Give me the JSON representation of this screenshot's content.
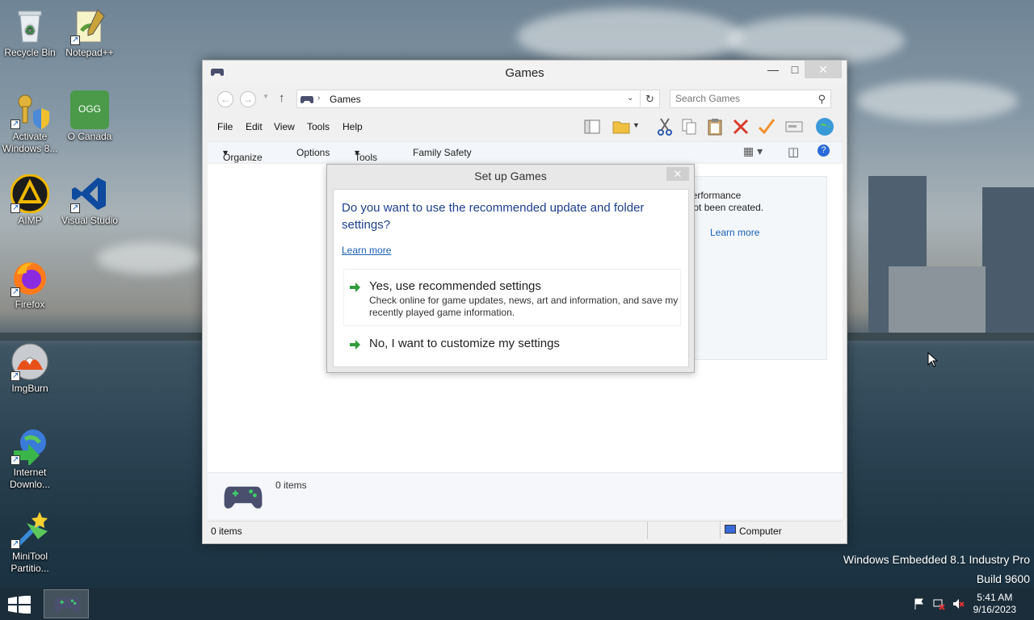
{
  "desktop": {
    "icons": [
      {
        "label": "Recycle Bin",
        "icon": "recycle-bin-icon"
      },
      {
        "label": "Notepad++",
        "icon": "notepadpp-icon"
      },
      {
        "label": "Activate Windows 8...",
        "icon": "activate-windows-icon"
      },
      {
        "label": "O Canada",
        "icon": "ogg-file-icon",
        "badge": "OGG"
      },
      {
        "label": "AIMP",
        "icon": "aimp-icon"
      },
      {
        "label": "Visual Studio",
        "icon": "visual-studio-icon"
      },
      {
        "label": "Firefox",
        "icon": "firefox-icon"
      },
      {
        "label": "ImgBurn",
        "icon": "imgburn-icon"
      },
      {
        "label": "Internet Downlo...",
        "icon": "internet-download-manager-icon"
      },
      {
        "label": "MiniTool Partitio...",
        "icon": "minitool-partition-icon"
      }
    ],
    "watermark_line1": "Windows Embedded 8.1 Industry Pro",
    "watermark_line2": "Build 9600"
  },
  "window": {
    "title": "Games",
    "address": "Games",
    "search_placeholder": "Search Games",
    "menu": [
      "File",
      "Edit",
      "View",
      "Tools",
      "Help"
    ],
    "commands": [
      "Organize",
      "Options",
      "Tools",
      "Family Safety"
    ],
    "side_pane": {
      "perf_line1": "omputer's Performance",
      "perf_line2": "nation has not been created.",
      "learn_more": "Learn more"
    },
    "details_count": "0 items",
    "status_left": "0 items",
    "status_right": "Computer"
  },
  "dialog": {
    "title": "Set up Games",
    "question": "Do you want to use the recommended update and folder settings?",
    "learn_more": "Learn more",
    "option1_head": "Yes, use recommended settings",
    "option1_sub": "Check online for game updates, news, art and information, and save my recently played game information.",
    "option2_head": "No, I want to customize my settings"
  },
  "taskbar": {
    "time": "5:41 AM",
    "date": "9/16/2023"
  },
  "colors": {
    "accent": "#1d3f8f",
    "link": "#1a5fb4",
    "green_arrow": "#2e9c3a",
    "taskbar": "#1c2c3a",
    "controller": "#4a4f6e"
  }
}
